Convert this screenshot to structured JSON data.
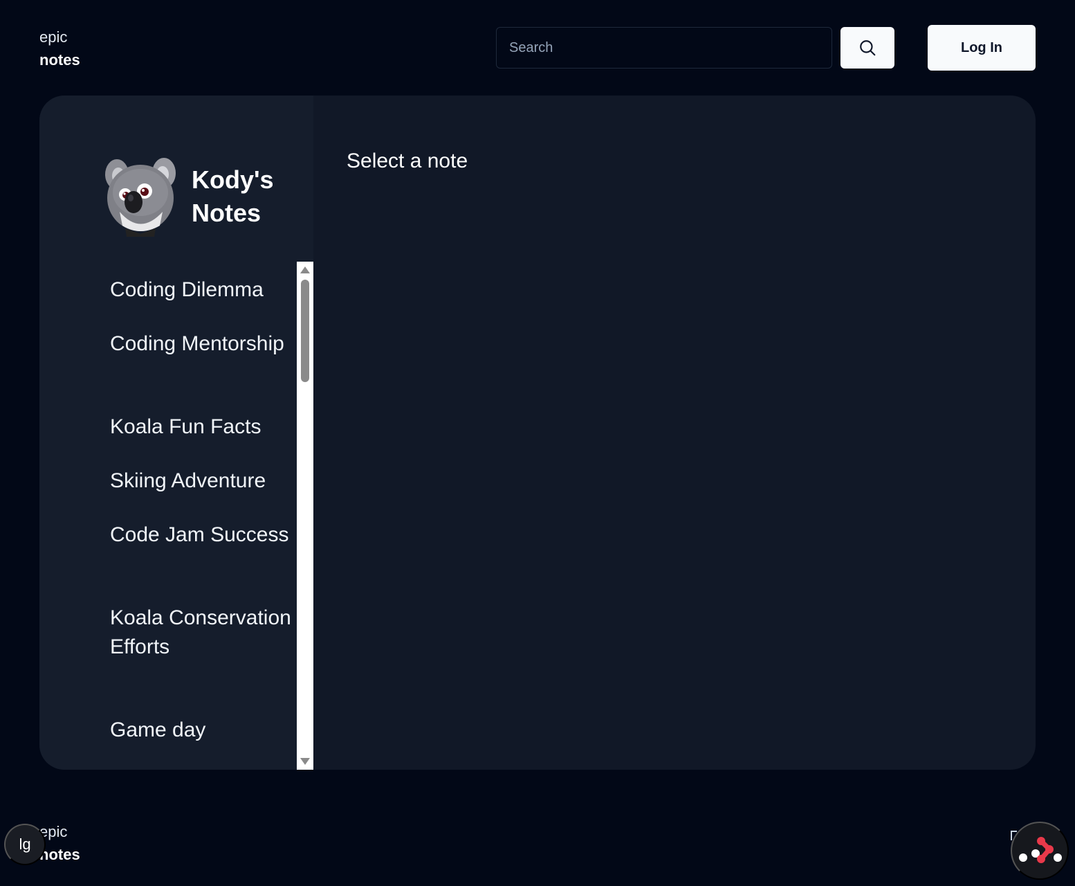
{
  "header": {
    "logo_line1": "epic",
    "logo_line2": "notes",
    "search_placeholder": "Search",
    "search_button_icon": "search-icon",
    "login_label": "Log In"
  },
  "sidebar": {
    "owner_name": "Kody's Notes",
    "avatar_icon": "koala-avatar",
    "notes": [
      "Coding Dilemma",
      "Coding Mentorship",
      "Koala Fun Facts",
      "Skiing Adventure",
      "Code Jam Success",
      "Koala Conservation Efforts",
      "Game day"
    ]
  },
  "main": {
    "heading": "Select a note"
  },
  "footer": {
    "logo_line1": "epic",
    "logo_line2": "notes",
    "theme_button_label": "lg",
    "devtools_icon": "remix-devtools-icon"
  },
  "colors": {
    "background": "#020817",
    "panel": "#111827",
    "sidebar": "#151d2c",
    "button": "#f8fafc",
    "accent": "#e8394a"
  }
}
